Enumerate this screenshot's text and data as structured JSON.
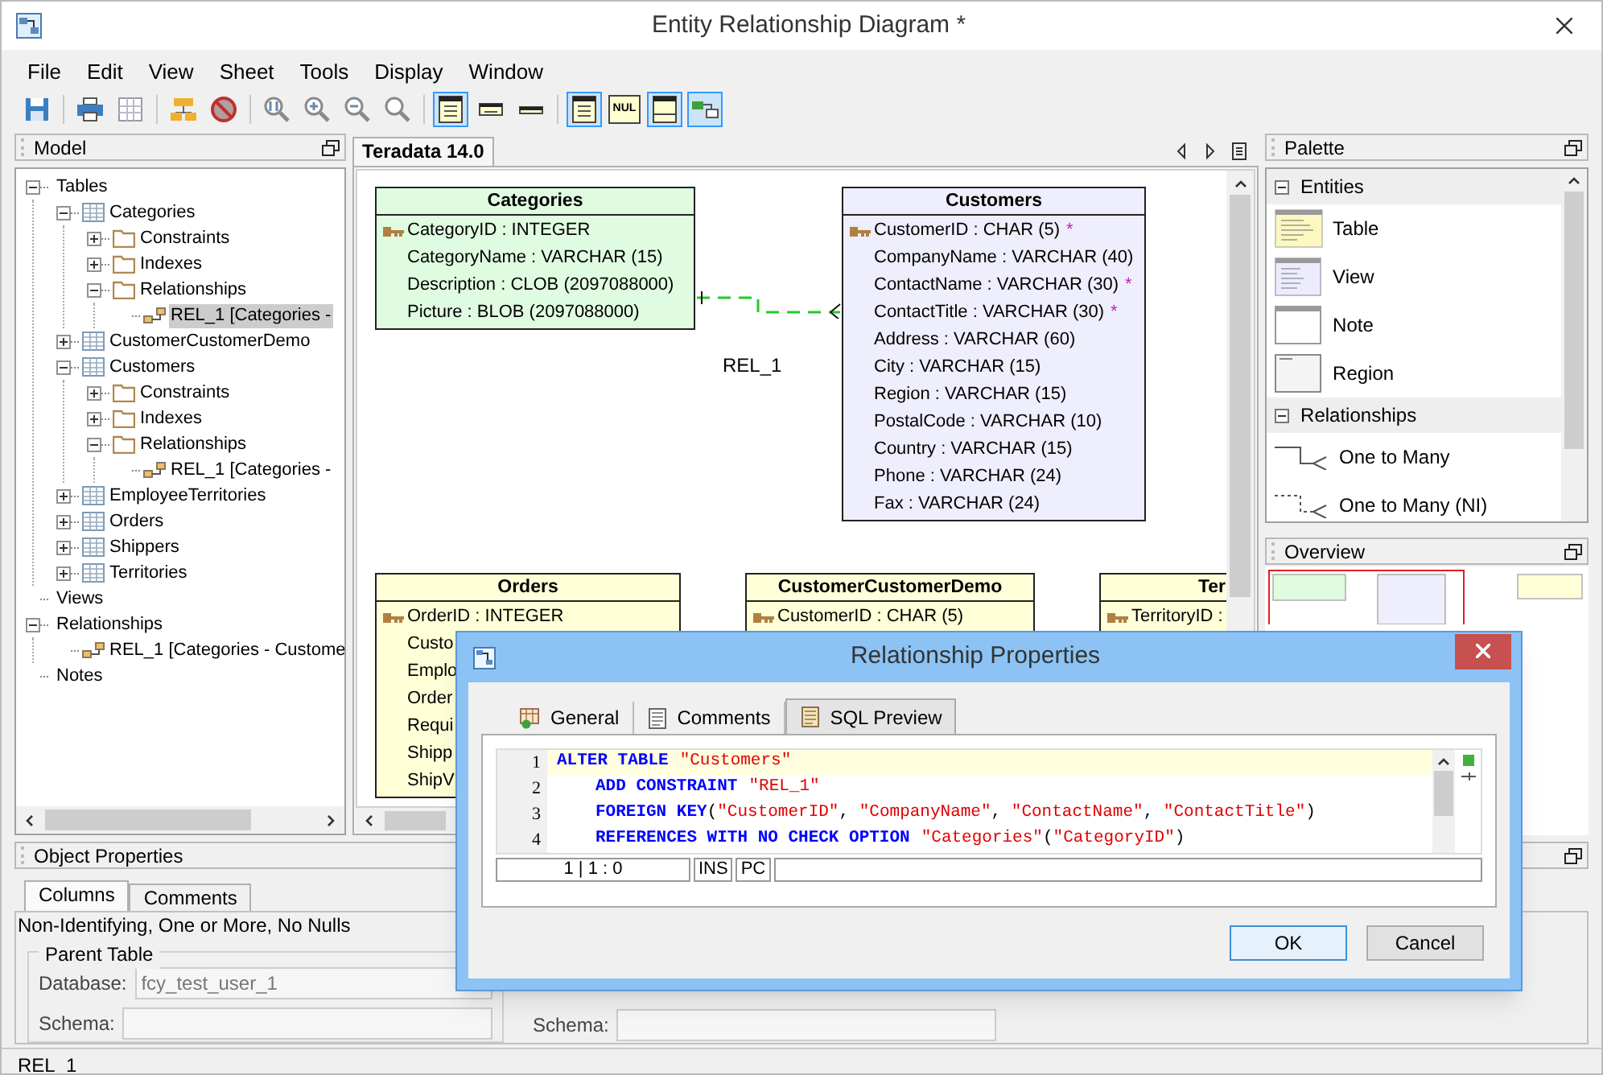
{
  "window": {
    "title": "Entity Relationship Diagram *"
  },
  "menu": [
    "File",
    "Edit",
    "View",
    "Sheet",
    "Tools",
    "Display",
    "Window"
  ],
  "toolbar": [
    {
      "kind": "save",
      "pressed": false
    },
    {
      "kind": "separator"
    },
    {
      "kind": "print",
      "pressed": false
    },
    {
      "kind": "grid",
      "pressed": false
    },
    {
      "kind": "separator"
    },
    {
      "kind": "layout",
      "pressed": false
    },
    {
      "kind": "forbid",
      "pressed": false
    },
    {
      "kind": "separator"
    },
    {
      "kind": "zoom-fit",
      "pressed": false
    },
    {
      "kind": "zoom-in",
      "pressed": false
    },
    {
      "kind": "zoom-out",
      "pressed": false
    },
    {
      "kind": "zoom",
      "pressed": false
    },
    {
      "kind": "separator"
    },
    {
      "kind": "table-full",
      "pressed": true
    },
    {
      "kind": "table-keys",
      "pressed": false
    },
    {
      "kind": "table-name",
      "pressed": false
    },
    {
      "kind": "separator"
    },
    {
      "kind": "table-full",
      "pressed": true
    },
    {
      "kind": "null",
      "pressed": false,
      "label": "NUL"
    },
    {
      "kind": "table-plain",
      "pressed": true
    },
    {
      "kind": "relation",
      "pressed": true
    }
  ],
  "model": {
    "title": "Model",
    "tree": [
      {
        "label": "Tables",
        "expanded": true,
        "selected": false,
        "children": [
          {
            "label": "Categories",
            "kind": "table",
            "expanded": true,
            "selected": false,
            "children": [
              {
                "label": "Constraints",
                "kind": "folder",
                "expanded": false,
                "selected": false
              },
              {
                "label": "Indexes",
                "kind": "folder",
                "expanded": false,
                "selected": false
              },
              {
                "label": "Relationships",
                "kind": "folder",
                "expanded": true,
                "selected": false,
                "children": [
                  {
                    "label": "REL_1 [Categories -",
                    "kind": "relationship",
                    "selected": true
                  }
                ]
              }
            ]
          },
          {
            "label": "CustomerCustomerDemo",
            "kind": "table",
            "expanded": false,
            "selected": false
          },
          {
            "label": "Customers",
            "kind": "table",
            "expanded": true,
            "selected": false,
            "children": [
              {
                "label": "Constraints",
                "kind": "folder",
                "expanded": false,
                "selected": false
              },
              {
                "label": "Indexes",
                "kind": "folder",
                "expanded": false,
                "selected": false
              },
              {
                "label": "Relationships",
                "kind": "folder",
                "expanded": true,
                "selected": false,
                "children": [
                  {
                    "label": "REL_1 [Categories -",
                    "kind": "relationship",
                    "selected": false
                  }
                ]
              }
            ]
          },
          {
            "label": "EmployeeTerritories",
            "kind": "table",
            "expanded": false,
            "selected": false
          },
          {
            "label": "Orders",
            "kind": "table",
            "expanded": false,
            "selected": false
          },
          {
            "label": "Shippers",
            "kind": "table",
            "expanded": false,
            "selected": false
          },
          {
            "label": "Territories",
            "kind": "table",
            "expanded": false,
            "selected": false
          }
        ]
      },
      {
        "label": "Views",
        "selected": false
      },
      {
        "label": "Relationships",
        "expanded": true,
        "selected": false,
        "children": [
          {
            "label": "REL_1 [Categories - Custome",
            "kind": "relationship",
            "selected": false
          }
        ]
      },
      {
        "label": "Notes",
        "selected": false
      }
    ]
  },
  "diagram": {
    "tab": "Teradata 14.0",
    "tables": [
      {
        "name": "Categories",
        "color": "#e0fce0",
        "columns": [
          {
            "text": "CategoryID : INTEGER",
            "key": true
          },
          {
            "text": "CategoryName : VARCHAR (15)",
            "key": false
          },
          {
            "text": "Description : CLOB (2097088000)",
            "key": false
          },
          {
            "text": "Picture : BLOB (2097088000)",
            "key": false
          }
        ]
      },
      {
        "name": "Customers",
        "color": "#eeeefc",
        "columns": [
          {
            "text": "CustomerID : CHAR (5)",
            "key": true,
            "marker": "*"
          },
          {
            "text": "CompanyName : VARCHAR (40)",
            "key": false
          },
          {
            "text": "ContactName : VARCHAR (30)",
            "key": false,
            "marker": "*"
          },
          {
            "text": "ContactTitle : VARCHAR (30)",
            "key": false,
            "marker": "*"
          },
          {
            "text": "Address : VARCHAR (60)",
            "key": false
          },
          {
            "text": "City : VARCHAR (15)",
            "key": false
          },
          {
            "text": "Region : VARCHAR (15)",
            "key": false
          },
          {
            "text": "PostalCode : VARCHAR (10)",
            "key": false
          },
          {
            "text": "Country : VARCHAR (15)",
            "key": false
          },
          {
            "text": "Phone : VARCHAR (24)",
            "key": false
          },
          {
            "text": "Fax : VARCHAR (24)",
            "key": false
          }
        ]
      },
      {
        "name": "Orders",
        "color": "#ffffd8",
        "columns": [
          {
            "text": "OrderID : INTEGER",
            "key": true
          },
          {
            "text": "Custo",
            "key": false
          },
          {
            "text": "Emplo",
            "key": false
          },
          {
            "text": "Order",
            "key": false
          },
          {
            "text": "Requi",
            "key": false
          },
          {
            "text": "Shipp",
            "key": false
          },
          {
            "text": "ShipV",
            "key": false
          }
        ]
      },
      {
        "name": "CustomerCustomerDemo",
        "color": "#ffffd8",
        "columns": [
          {
            "text": "CustomerID : CHAR (5)",
            "key": true
          }
        ]
      },
      {
        "name": "Ter",
        "color": "#ffffd8",
        "columns": [
          {
            "text": "TerritoryID :",
            "key": true
          }
        ]
      }
    ],
    "relationship": {
      "label": "REL_1"
    }
  },
  "palette": {
    "title": "Palette",
    "sections": [
      {
        "title": "Entities",
        "expanded": true,
        "items": [
          {
            "label": "Table",
            "kind": "table"
          },
          {
            "label": "View",
            "kind": "view"
          },
          {
            "label": "Note",
            "kind": "note"
          },
          {
            "label": "Region",
            "kind": "region"
          }
        ]
      },
      {
        "title": "Relationships",
        "expanded": true,
        "items": [
          {
            "label": "One to Many",
            "kind": "solid"
          },
          {
            "label": "One to Many (NI)",
            "kind": "dashed"
          }
        ]
      }
    ]
  },
  "overview": {
    "title": "Overview"
  },
  "object_properties": {
    "title": "Object Properties",
    "tabs": [
      {
        "label": "Columns",
        "selected": true
      },
      {
        "label": "Comments",
        "selected": false
      }
    ],
    "description": "Non-Identifying, One or More, No Nulls",
    "parent": {
      "legend": "Parent Table",
      "database_label": "Database:",
      "database_value": "fcy_test_user_1",
      "schema_label": "Schema:"
    },
    "child": {
      "schema_label": "Schema:"
    }
  },
  "dialog": {
    "title": "Relationship Properties",
    "tabs": [
      {
        "label": "General",
        "selected": false,
        "kind": "general"
      },
      {
        "label": "Comments",
        "selected": false,
        "kind": "comments"
      },
      {
        "label": "SQL Preview",
        "selected": true,
        "kind": "sql"
      }
    ],
    "sql": [
      {
        "number": "1",
        "current": true,
        "indented": false,
        "tokens": [
          {
            "kind": "keyword",
            "text": "ALTER TABLE"
          },
          {
            "kind": "string",
            "text": "\"Customers\""
          }
        ]
      },
      {
        "number": "2",
        "current": false,
        "indented": true,
        "tokens": [
          {
            "kind": "keyword",
            "text": "ADD CONSTRAINT"
          },
          {
            "kind": "string",
            "text": "\"REL_1\""
          }
        ]
      },
      {
        "number": "3",
        "current": false,
        "indented": true,
        "tokens": [
          {
            "kind": "keyword",
            "text": "FOREIGN KEY"
          },
          {
            "kind": "plain",
            "text": "("
          },
          {
            "kind": "string",
            "text": "\"CustomerID\""
          },
          {
            "kind": "plain",
            "text": ", "
          },
          {
            "kind": "string",
            "text": "\"CompanyName\""
          },
          {
            "kind": "plain",
            "text": ", "
          },
          {
            "kind": "string",
            "text": "\"ContactName\""
          },
          {
            "kind": "plain",
            "text": ", "
          },
          {
            "kind": "string",
            "text": "\"ContactTitle\""
          },
          {
            "kind": "plain",
            "text": ")"
          }
        ]
      },
      {
        "number": "4",
        "current": false,
        "indented": true,
        "tokens": [
          {
            "kind": "keyword",
            "text": "REFERENCES WITH NO CHECK OPTION"
          },
          {
            "kind": "string",
            "text": "\"Categories\""
          },
          {
            "kind": "plain",
            "text": "("
          },
          {
            "kind": "string",
            "text": "\"CategoryID\""
          },
          {
            "kind": "plain",
            "text": ")"
          }
        ]
      }
    ],
    "editor_status": [
      "1 | 1 : 0",
      "INS",
      "PC"
    ],
    "buttons": [
      {
        "label": "OK",
        "default": true
      },
      {
        "label": "Cancel",
        "default": false
      }
    ]
  },
  "status_bar": "REL_1"
}
